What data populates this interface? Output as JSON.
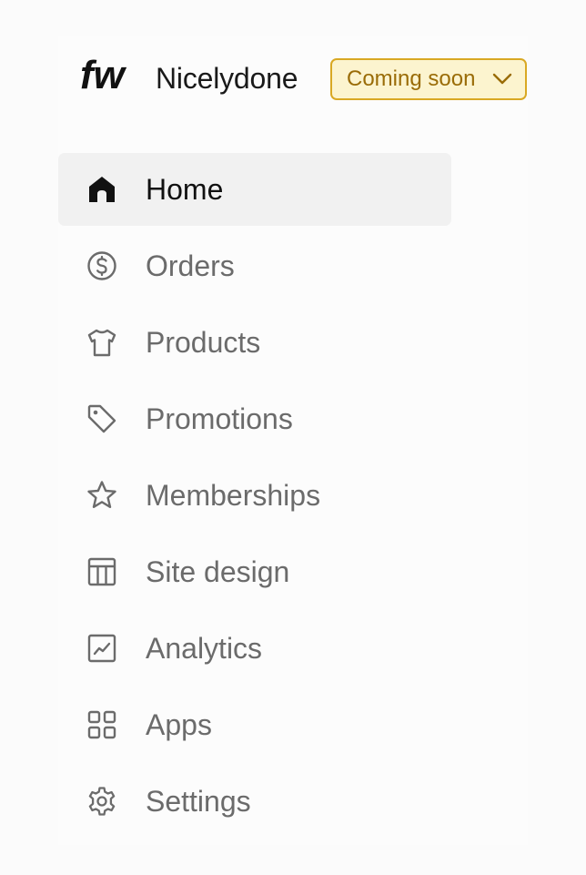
{
  "header": {
    "logo_text": "fw",
    "brand_name": "Nicelydone",
    "status_label": "Coming soon",
    "status_icon": "chevron-down-icon"
  },
  "colors": {
    "status_bg": "#fcf4cf",
    "status_border": "#d9a823",
    "status_text": "#9a6c07",
    "active_bg": "#f1f1f1",
    "nav_text": "#6b6b6b",
    "nav_text_active": "#111111"
  },
  "nav": {
    "items": [
      {
        "label": "Home",
        "icon": "home-icon",
        "active": true
      },
      {
        "label": "Orders",
        "icon": "dollar-circle-icon",
        "active": false
      },
      {
        "label": "Products",
        "icon": "tshirt-icon",
        "active": false
      },
      {
        "label": "Promotions",
        "icon": "tag-icon",
        "active": false
      },
      {
        "label": "Memberships",
        "icon": "star-icon",
        "active": false
      },
      {
        "label": "Site design",
        "icon": "layout-icon",
        "active": false
      },
      {
        "label": "Analytics",
        "icon": "chart-icon",
        "active": false
      },
      {
        "label": "Apps",
        "icon": "apps-grid-icon",
        "active": false
      },
      {
        "label": "Settings",
        "icon": "gear-icon",
        "active": false
      }
    ]
  }
}
